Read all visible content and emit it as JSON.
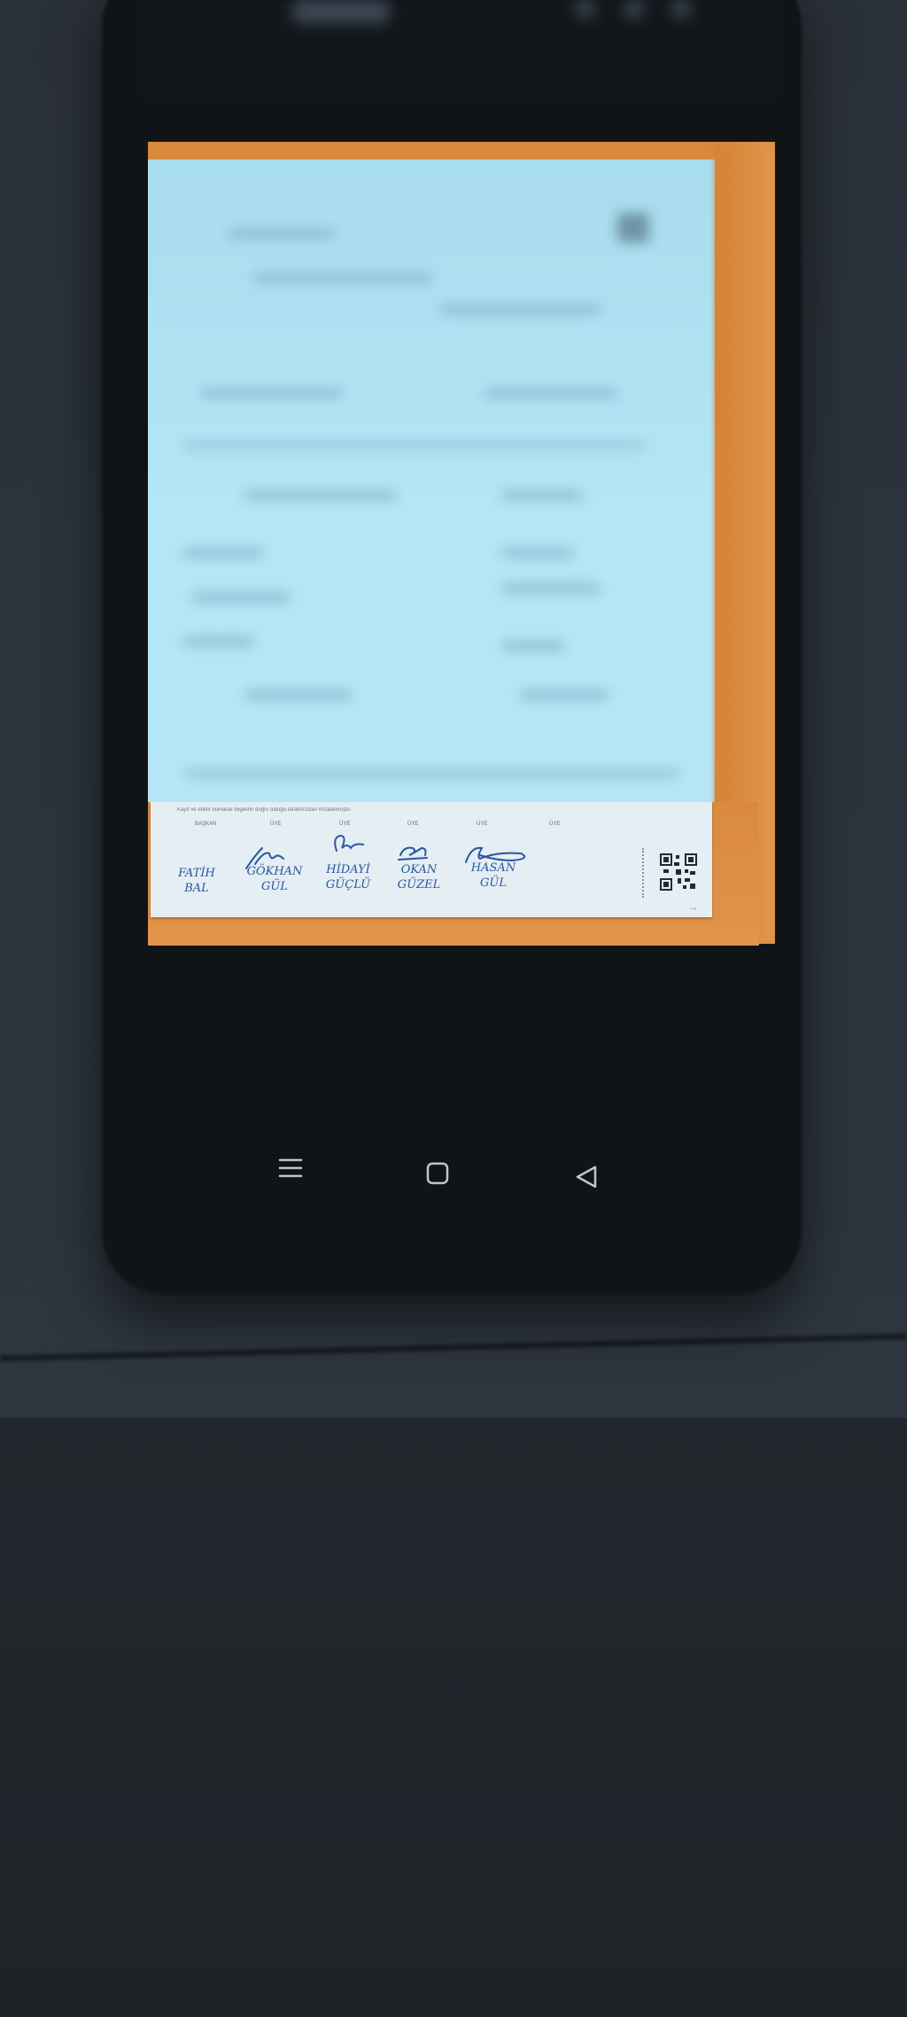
{
  "scene": {
    "description_colors": {
      "table": "#2b333c",
      "phone_body": "#111417",
      "wood": "#d9893b",
      "paper": "#b4e6f6",
      "ink": "#2b55a0"
    }
  },
  "document": {
    "fine_print": "Kayıt ve etiket numaralı bilgilerin doğru olduğu tarafımızdan imzalanmıştır.",
    "roles": [
      "BAŞKAN",
      "ÜYE",
      "ÜYE",
      "ÜYE",
      "ÜYE",
      "ÜYE"
    ],
    "signatories": [
      {
        "line1": "FATİH",
        "line2": "BAL"
      },
      {
        "line1": "GÖKHAN",
        "line2": "GÜL"
      },
      {
        "line1": "HİDAYİ",
        "line2": "GÜÇLÜ"
      },
      {
        "line1": "OKAN",
        "line2": "GÜZEL"
      },
      {
        "line1": "HASAN",
        "line2": "GÜL"
      }
    ]
  },
  "nav_bar": {
    "icons": [
      "menu-icon",
      "home-icon",
      "back-icon"
    ]
  }
}
